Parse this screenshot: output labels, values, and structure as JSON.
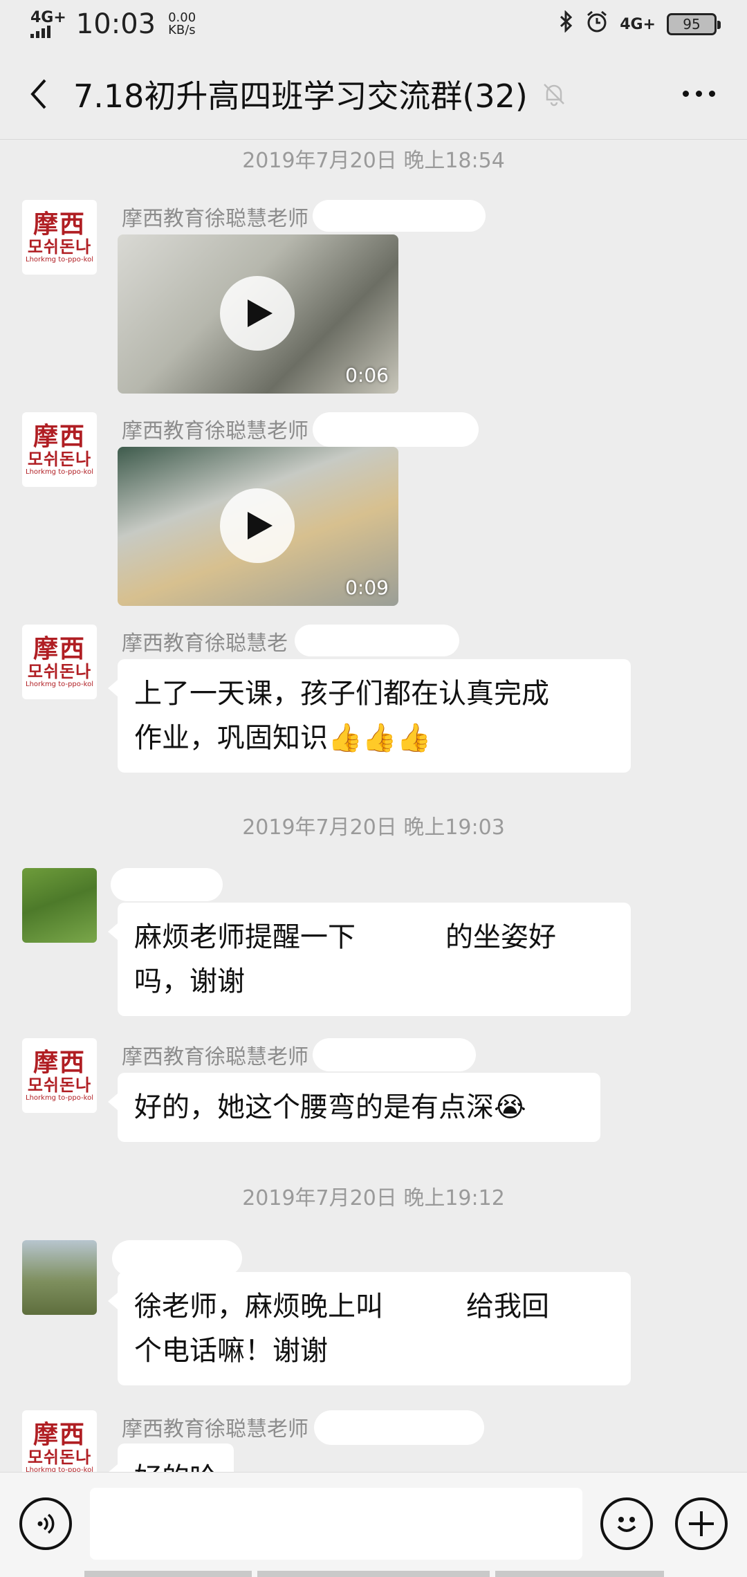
{
  "status_bar": {
    "network_left": "4G+",
    "time": "10:03",
    "speed_value": "0.00",
    "speed_unit": "KB/s",
    "network_right": "4G+",
    "battery": "95",
    "icons": [
      "signal-icon",
      "bluetooth-icon",
      "alarm-icon",
      "battery-icon"
    ]
  },
  "header": {
    "title": "7.18初升高四班学习交流群(32)",
    "icons": [
      "back-icon",
      "mute-bell-icon",
      "more-icon"
    ]
  },
  "chat": {
    "timestamps": [
      "2019年7月20日 晚上18:54",
      "2019年7月20日 晚上19:03",
      "2019年7月20日 晚上19:12"
    ],
    "messages": [
      {
        "sender": "摩西教育徐聪慧老师",
        "type": "video",
        "duration": "0:06"
      },
      {
        "sender": "摩西教育徐聪慧老师",
        "type": "video",
        "duration": "0:09"
      },
      {
        "sender": "摩西教育徐聪慧老",
        "type": "text",
        "text_line1": "上了一天课，孩子们都在认真完成",
        "text_line2": "作业，巩固知识",
        "emoji": "👍👍👍"
      },
      {
        "sender": "",
        "type": "text",
        "text_line1": "麻烦老师提醒一下",
        "text_line1b": "的坐姿好",
        "text_line2": "吗，谢谢"
      },
      {
        "sender": "摩西教育徐聪慧老师",
        "type": "text",
        "text_line1": "好的，她这个腰弯的是有点深",
        "emoji": "😭"
      },
      {
        "sender": "",
        "type": "text",
        "text_line1": "徐老师，麻烦晚上叫",
        "text_line1b": "给我回",
        "text_line2": "个电话嘛！谢谢"
      },
      {
        "sender": "摩西教育徐聪慧老师",
        "type": "text",
        "text_line1": "好的哈"
      }
    ],
    "avatar_logo": {
      "top": "摩西",
      "mid": "모쉬돈나",
      "sub": "Lhorkmg to-ppo-kol"
    }
  },
  "input_bar": {
    "placeholder": "",
    "icons": [
      "voice-icon",
      "emoji-icon",
      "plus-icon"
    ]
  }
}
